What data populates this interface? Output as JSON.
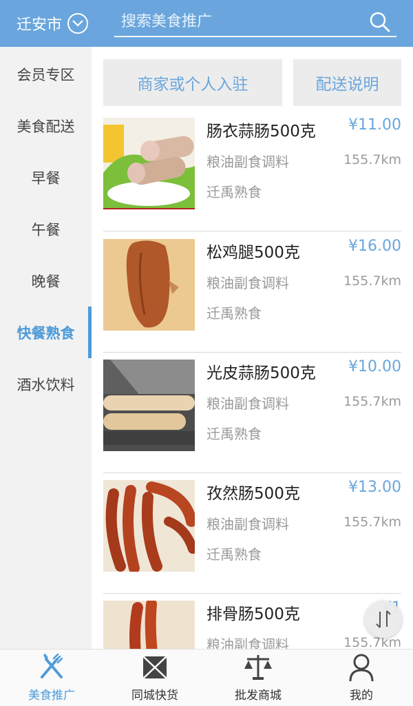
{
  "header": {
    "city": "迁安市",
    "search_placeholder": "搜索美食推广"
  },
  "sidebar": {
    "items": [
      {
        "label": "会员专区"
      },
      {
        "label": "美食配送"
      },
      {
        "label": "早餐"
      },
      {
        "label": "午餐"
      },
      {
        "label": "晚餐"
      },
      {
        "label": "快餐熟食",
        "active": true
      },
      {
        "label": "酒水饮料"
      }
    ]
  },
  "main": {
    "join_button": "商家或个人入驻",
    "delivery_button": "配送说明",
    "products": [
      {
        "name": "肠衣蒜肠500克",
        "price": "¥11.00",
        "category": "粮油副食调料",
        "distance": "155.7km",
        "shop": "迁禹熟食"
      },
      {
        "name": "松鸡腿500克",
        "price": "¥16.00",
        "category": "粮油副食调料",
        "distance": "155.7km",
        "shop": "迁禹熟食"
      },
      {
        "name": "光皮蒜肠500克",
        "price": "¥10.00",
        "category": "粮油副食调料",
        "distance": "155.7km",
        "shop": "迁禹熟食"
      },
      {
        "name": "孜然肠500克",
        "price": "¥13.00",
        "category": "粮油副食调料",
        "distance": "155.7km",
        "shop": "迁禹熟食"
      },
      {
        "name": "排骨肠500克",
        "price": "¥1",
        "category": "粮油副食调料",
        "distance": "155.7km",
        "shop": ""
      }
    ]
  },
  "bottom_nav": {
    "items": [
      {
        "label": "美食推广",
        "icon": "fork-knife-icon",
        "active": true
      },
      {
        "label": "同城快货",
        "icon": "package-icon"
      },
      {
        "label": "批发商城",
        "icon": "scale-icon"
      },
      {
        "label": "我的",
        "icon": "person-icon"
      }
    ]
  },
  "colors": {
    "accent": "#6aa6dd",
    "active": "#4f9bd9"
  }
}
